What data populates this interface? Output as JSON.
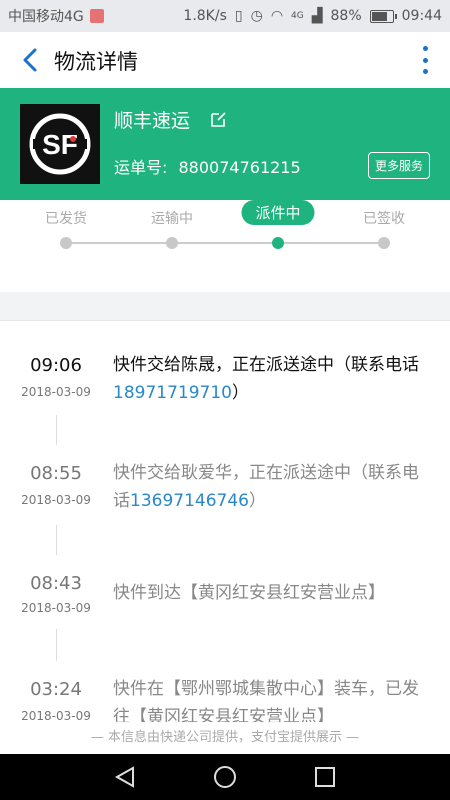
{
  "status_bar": {
    "carrier": "中国移动4G",
    "speed": "1.8K/s",
    "network": "4G",
    "battery": "88%",
    "battery_level": 0.88,
    "time": "09:44"
  },
  "header": {
    "title": "物流详情"
  },
  "carrier_card": {
    "name": "顺丰速运",
    "waybill_label": "运单号:",
    "waybill_number": "880074761215",
    "more_service": "更多服务",
    "accent_color": "#1fb37f"
  },
  "progress": {
    "steps": [
      {
        "label": "已发货"
      },
      {
        "label": "运输中"
      },
      {
        "label": "派件中"
      },
      {
        "label": "已签收"
      }
    ],
    "active_index": 2
  },
  "timeline": [
    {
      "time": "09:06",
      "date": "2018-03-09",
      "text": "快件交给陈晟，正在派送途中（联系电话",
      "phone": "18971719710",
      "tail": "）"
    },
    {
      "time": "08:55",
      "date": "2018-03-09",
      "text": "快件交给耿爱华，正在派送途中（联系电话",
      "phone": "13697146746",
      "tail": "）"
    },
    {
      "time": "08:43",
      "date": "2018-03-09",
      "text": "快件到达【黄冈红安县红安营业点】",
      "phone": "",
      "tail": ""
    },
    {
      "time": "03:24",
      "date": "2018-03-09",
      "text": "快件在【鄂州鄂城集散中心】装车，已发往【黄冈红安县红安营业点】",
      "phone": "",
      "tail": ""
    }
  ],
  "footer_note": "—  本信息由快递公司提供，支付宝提供展示  —"
}
